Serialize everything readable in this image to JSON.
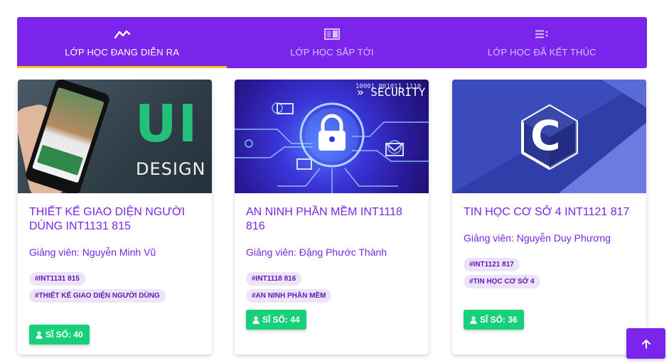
{
  "tabs": [
    {
      "label": "LỚP HỌC ĐANG DIỄN RA",
      "icon": "trend-line-icon",
      "active": true
    },
    {
      "label": "LỚP HỌC SẮP TỚI",
      "icon": "calendar-panel-icon",
      "active": false
    },
    {
      "label": "LỚP HỌC ĐÃ KẾT THÚC",
      "icon": "list-check-icon",
      "active": false
    }
  ],
  "cards": [
    {
      "image_text": {
        "line1": "UI",
        "line2": "DESIGN"
      },
      "title": "THIẾT KẾ GIAO DIỆN NGƯỜI DÙNG INT1131 815",
      "teacher": "Giảng viên: Nguyễn Minh Vũ",
      "tags": [
        "#INT1131 815",
        "#THIẾT KẾ GIAO DIỆN NGƯỜI DÙNG"
      ],
      "count": "SĨ SỐ: 40"
    },
    {
      "image_text": {
        "line1": "» SECURITY"
      },
      "title": "AN NINH PHẦN MỀM INT1118 816",
      "teacher": "Giảng viên: Đặng Phước Thành",
      "tags": [
        "#INT1118 816",
        "#AN NINH PHẦN MỀM"
      ],
      "count": "SĨ SỐ: 44"
    },
    {
      "image_text": {
        "line1": "C"
      },
      "title": "TIN HỌC CƠ SỞ 4 INT1121 817",
      "teacher": "Giảng viên: Nguyễn Duy Phương",
      "tags": [
        "#INT1121 817",
        "#TIN HỌC CƠ SỞ 4"
      ],
      "count": "SĨ SỐ: 36"
    }
  ],
  "colors": {
    "primary": "#7b24ec",
    "active_underline": "#f5c518",
    "badge": "#18d07a",
    "tag_bg": "#ede4fb"
  },
  "scroll_top_icon": "arrow-up-icon"
}
